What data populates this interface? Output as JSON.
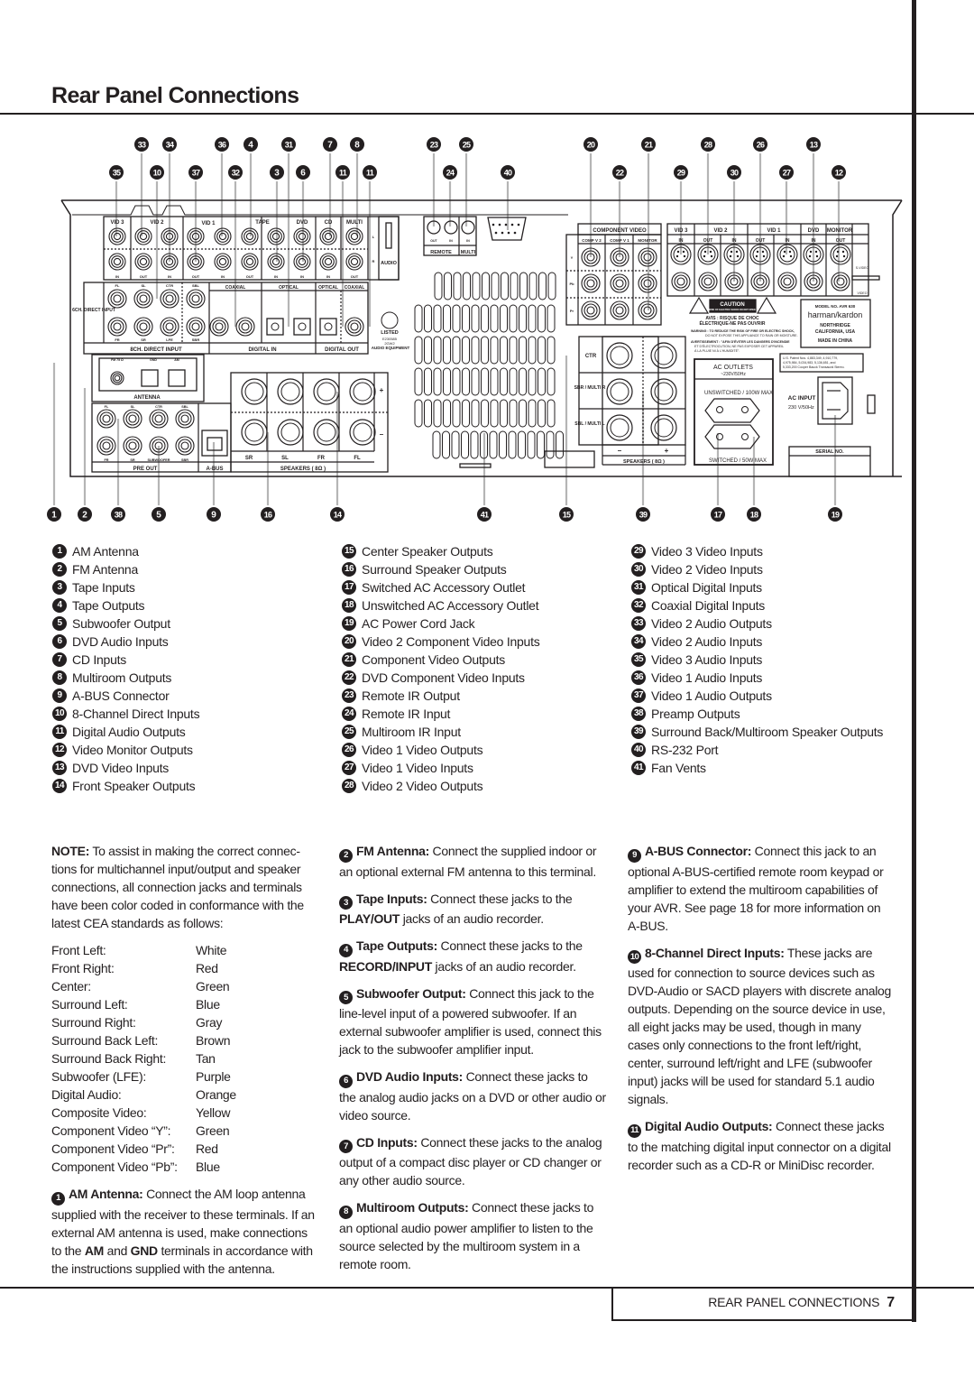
{
  "header": {
    "title": "Rear Panel Connections"
  },
  "diagram": {
    "callouts_top": [
      "33",
      "34",
      "36",
      "4",
      "31",
      "7",
      "8",
      "23",
      "25",
      "20",
      "21",
      "28",
      "26",
      "13"
    ],
    "callouts_second": [
      "35",
      "10",
      "37",
      "32",
      "3",
      "6",
      "11",
      "11",
      "24",
      "40",
      "22",
      "29",
      "30",
      "27",
      "12"
    ],
    "callouts_bottom": [
      "1",
      "2",
      "38",
      "5",
      "9",
      "16",
      "14",
      "41",
      "15",
      "39",
      "17",
      "18",
      "19"
    ],
    "labels": {
      "vid3": "VID 3",
      "vid2": "VID 2",
      "vid1": "VID 1",
      "tape": "TAPE",
      "dvd": "DVD",
      "cd": "CD",
      "multi": "MULTI",
      "audio": "AUDIO",
      "l": "L",
      "r": "R",
      "in": "IN",
      "out": "OUT",
      "six_ch": "6CH. DIRECT INPUT",
      "eight_ch": "8CH. DIRECT INPUT",
      "digital_in": "DIGITAL IN",
      "digital_out": "DIGITAL OUT",
      "coaxial": "COAXIAL",
      "optical": "OPTICAL",
      "fl": "FL",
      "sl": "SL",
      "ctr": "CTR",
      "sbl": "SBL",
      "fr": "FR",
      "sr": "SR",
      "lfe": "LFE",
      "sbr": "SBR",
      "subwoofer": "SUBWOOFER",
      "fm": "FM 75 Ω",
      "gnd": "GND",
      "am": "AM",
      "antenna": "ANTENNA",
      "pre_out": "PRE OUT",
      "abus": "A-BUS",
      "speakers": "SPEAKERS ( 8Ω )",
      "remote": "REMOTE",
      "multi_ir": "MULTI",
      "ul_listed": "LISTED",
      "ul_code": "E230585",
      "ul_code2": "2GW2",
      "audio_equipment": "AUDIO EQUIPMENT",
      "component_video": "COMPONENT VIDEO",
      "comp_v2": "COMP V 2",
      "comp_v1": "COMP V 1",
      "monitor": "MONITOR",
      "y": "Y",
      "pb": "Pb",
      "pr": "Pr",
      "s_video": "S-VIDEO",
      "video": "VIDEO",
      "caution": "CAUTION",
      "caution_sub": "RISK OF ELECTRIC SHOCK DO NOT OPEN",
      "avis": "AVIS : RISQUE DE CHOC",
      "avis2": "ÉLECTRIQUE-NE PAS OUVRIR",
      "warning": "WARNING : TO REDUCE THE RISK OF FIRE OR ELECTRIC SHOCK,",
      "warning2": "DO NOT EXPOSE THIS APPLIANCE TO RAIN OR MOISTURE.",
      "avert": "AVERTISSEMENT : \"AFIN D'ÉVITER LES DANGERS D'INCENDIE",
      "avert2": "ET D'ÉLECTROCUTION, NE PAS EXPOSER CET APPAREIL",
      "avert3": "À LA PLUIE NI À L'HUMIDITÉ\".",
      "model": "MODEL NO. AVR 630",
      "brand": "harman/kardon",
      "northridge": "NORTHRIDGE",
      "california": "CALIFORNIA, USA",
      "made_in": "MADE IN CHINA",
      "patent1": "U.S. Patent Nos. 4,883,349, 4,910,779,",
      "patent2": "4,975,984, 5,034,983, 5,136,651, and",
      "patent3": "5,333,200 Cooper Bauck Transaural Stereo.",
      "sbr_multi_r": "SBR / MULTI R",
      "sbl_multi_l": "SBL / MULTI L",
      "minus": "–",
      "plus": "+",
      "ac_outlets": "AC OUTLETS",
      "ac_outlets_v": "~230V/50Hz",
      "unswitched": "UNSWITCHED / 100W MAX",
      "switched": "SWITCHED / 50W MAX",
      "ac_input": "AC INPUT",
      "ac_input_v": "230 V/50Hz",
      "serial": "SERIAL NO."
    }
  },
  "legend": [
    [
      {
        "n": "1",
        "label": "AM Antenna"
      },
      {
        "n": "2",
        "label": "FM Antenna"
      },
      {
        "n": "3",
        "label": "Tape Inputs"
      },
      {
        "n": "4",
        "label": "Tape Outputs"
      },
      {
        "n": "5",
        "label": "Subwoofer Output"
      },
      {
        "n": "6",
        "label": "DVD Audio Inputs"
      },
      {
        "n": "7",
        "label": "CD Inputs"
      },
      {
        "n": "8",
        "label": "Multiroom Outputs"
      },
      {
        "n": "9",
        "label": "A-BUS Connector"
      },
      {
        "n": "10",
        "label": "8-Channel Direct Inputs"
      },
      {
        "n": "11",
        "label": "Digital Audio Outputs"
      },
      {
        "n": "12",
        "label": "Video Monitor Outputs"
      },
      {
        "n": "13",
        "label": "DVD Video Inputs"
      },
      {
        "n": "14",
        "label": "Front Speaker Outputs"
      }
    ],
    [
      {
        "n": "15",
        "label": "Center Speaker Outputs"
      },
      {
        "n": "16",
        "label": "Surround Speaker Outputs"
      },
      {
        "n": "17",
        "label": "Switched AC Accessory Outlet"
      },
      {
        "n": "18",
        "label": "Unswitched AC Accessory Outlet"
      },
      {
        "n": "19",
        "label": "AC Power Cord Jack"
      },
      {
        "n": "20",
        "label": "Video 2 Component Video Inputs"
      },
      {
        "n": "21",
        "label": "Component Video Outputs"
      },
      {
        "n": "22",
        "label": "DVD Component Video Inputs"
      },
      {
        "n": "23",
        "label": "Remote IR Output"
      },
      {
        "n": "24",
        "label": "Remote IR Input"
      },
      {
        "n": "25",
        "label": "Multiroom IR Input"
      },
      {
        "n": "26",
        "label": "Video 1 Video Outputs"
      },
      {
        "n": "27",
        "label": "Video 1 Video Inputs"
      },
      {
        "n": "28",
        "label": "Video 2 Video Outputs"
      }
    ],
    [
      {
        "n": "29",
        "label": "Video 3 Video Inputs"
      },
      {
        "n": "30",
        "label": "Video 2 Video Inputs"
      },
      {
        "n": "31",
        "label": "Optical Digital Inputs"
      },
      {
        "n": "32",
        "label": "Coaxial Digital Inputs"
      },
      {
        "n": "33",
        "label": "Video 2 Audio Outputs"
      },
      {
        "n": "34",
        "label": "Video 2 Audio Inputs"
      },
      {
        "n": "35",
        "label": "Video 3 Audio Inputs"
      },
      {
        "n": "36",
        "label": "Video 1 Audio Inputs"
      },
      {
        "n": "37",
        "label": "Video 1 Audio Outputs"
      },
      {
        "n": "38",
        "label": "Preamp Outputs"
      },
      {
        "n": "39",
        "label": "Surround Back/Multiroom Speaker Outputs"
      },
      {
        "n": "40",
        "label": "RS-232 Port"
      },
      {
        "n": "41",
        "label": "Fan Vents"
      }
    ]
  ],
  "note": {
    "segments": [
      {
        "t": "NOTE:",
        "b": true
      },
      {
        "t": " To assist in making the correct connec-tions for multichannel input/output and speaker connections, all connection jacks and terminals have been color coded in conformance with the latest CEA standards as follows:"
      }
    ],
    "color_codes": [
      {
        "channel": "Front Left:",
        "color": "White"
      },
      {
        "channel": "Front Right:",
        "color": "Red"
      },
      {
        "channel": "Center:",
        "color": "Green"
      },
      {
        "channel": "Surround Left:",
        "color": "Blue"
      },
      {
        "channel": "Surround Right:",
        "color": "Gray"
      },
      {
        "channel": "Surround Back Left:",
        "color": "Brown"
      },
      {
        "channel": "Surround Back Right:",
        "color": "Tan"
      },
      {
        "channel": "Subwoofer (LFE):",
        "color": "Purple"
      },
      {
        "channel": "Digital Audio:",
        "color": "Orange"
      },
      {
        "channel": "Composite Video:",
        "color": "Yellow"
      },
      {
        "channel": "Component Video “Y”:",
        "color": "Green"
      },
      {
        "channel": "Component Video “Pr”:",
        "color": "Red"
      },
      {
        "channel": "Component Video “Pb”:",
        "color": "Blue"
      }
    ]
  },
  "descriptions": [
    [
      {
        "n": "1",
        "segments": [
          {
            "t": "AM Antenna:",
            "b": true
          },
          {
            "t": " Connect the AM loop antenna supplied with the receiver to these terminals. If an external AM antenna is used, make connections to the "
          },
          {
            "t": "AM",
            "b": true
          },
          {
            "t": " and "
          },
          {
            "t": "GND",
            "b": true
          },
          {
            "t": " terminals in accordance with the instructions supplied with the antenna."
          }
        ]
      }
    ],
    [
      {
        "n": "2",
        "segments": [
          {
            "t": "FM Antenna:",
            "b": true
          },
          {
            "t": " Connect the supplied indoor or an optional external FM antenna to this terminal."
          }
        ]
      },
      {
        "n": "3",
        "segments": [
          {
            "t": "Tape Inputs:",
            "b": true
          },
          {
            "t": " Connect these jacks to the "
          },
          {
            "t": "PLAY/OUT",
            "b": true
          },
          {
            "t": " jacks of an audio recorder."
          }
        ]
      },
      {
        "n": "4",
        "segments": [
          {
            "t": "Tape Outputs:",
            "b": true
          },
          {
            "t": " Connect these jacks to the "
          },
          {
            "t": "RECORD/INPUT",
            "b": true
          },
          {
            "t": " jacks of an audio recorder."
          }
        ]
      },
      {
        "n": "5",
        "segments": [
          {
            "t": "Subwoofer Output:",
            "b": true
          },
          {
            "t": " Connect this jack to the line-level input of a powered subwoofer. If an external subwoofer amplifier is used, connect this jack to the subwoofer amplifier input."
          }
        ]
      },
      {
        "n": "6",
        "segments": [
          {
            "t": "DVD Audio Inputs:",
            "b": true
          },
          {
            "t": " Connect these jacks to the analog audio jacks on a DVD or other audio or video source."
          }
        ]
      },
      {
        "n": "7",
        "segments": [
          {
            "t": "CD Inputs:",
            "b": true
          },
          {
            "t": " Connect these jacks to the analog output of a compact disc player or CD changer or any other audio source."
          }
        ]
      },
      {
        "n": "8",
        "segments": [
          {
            "t": "Multiroom Outputs:",
            "b": true
          },
          {
            "t": " Connect these jacks to an optional audio power amplifier to listen to the source selected by the multiroom system in a remote room."
          }
        ]
      }
    ],
    [
      {
        "n": "9",
        "segments": [
          {
            "t": "A-BUS Connector:",
            "b": true
          },
          {
            "t": " Connect this jack to an optional A-BUS-certified remote room keypad or amplifier to extend the multiroom capabilities of your AVR. See page 18 for more information on A-BUS."
          }
        ]
      },
      {
        "n": "10",
        "segments": [
          {
            "t": "8-Channel Direct Inputs:",
            "b": true
          },
          {
            "t": " These jacks are used for connection to source devices such as DVD-Audio or SACD players with discrete analog outputs. Depending on the source device in use, all eight jacks may be used, though in many cases only connections to the front left/right, center, surround left/right and LFE (subwoofer input) jacks will be used for standard 5.1 audio signals."
          }
        ]
      },
      {
        "n": "11",
        "segments": [
          {
            "t": "Digital Audio Outputs:",
            "b": true
          },
          {
            "t": " Connect these jacks to the matching digital input connector on a digital recorder such as a CD-R or MiniDisc recorder."
          }
        ]
      }
    ]
  ],
  "footer": {
    "section": "REAR PANEL CONNECTIONS",
    "page": "7"
  }
}
